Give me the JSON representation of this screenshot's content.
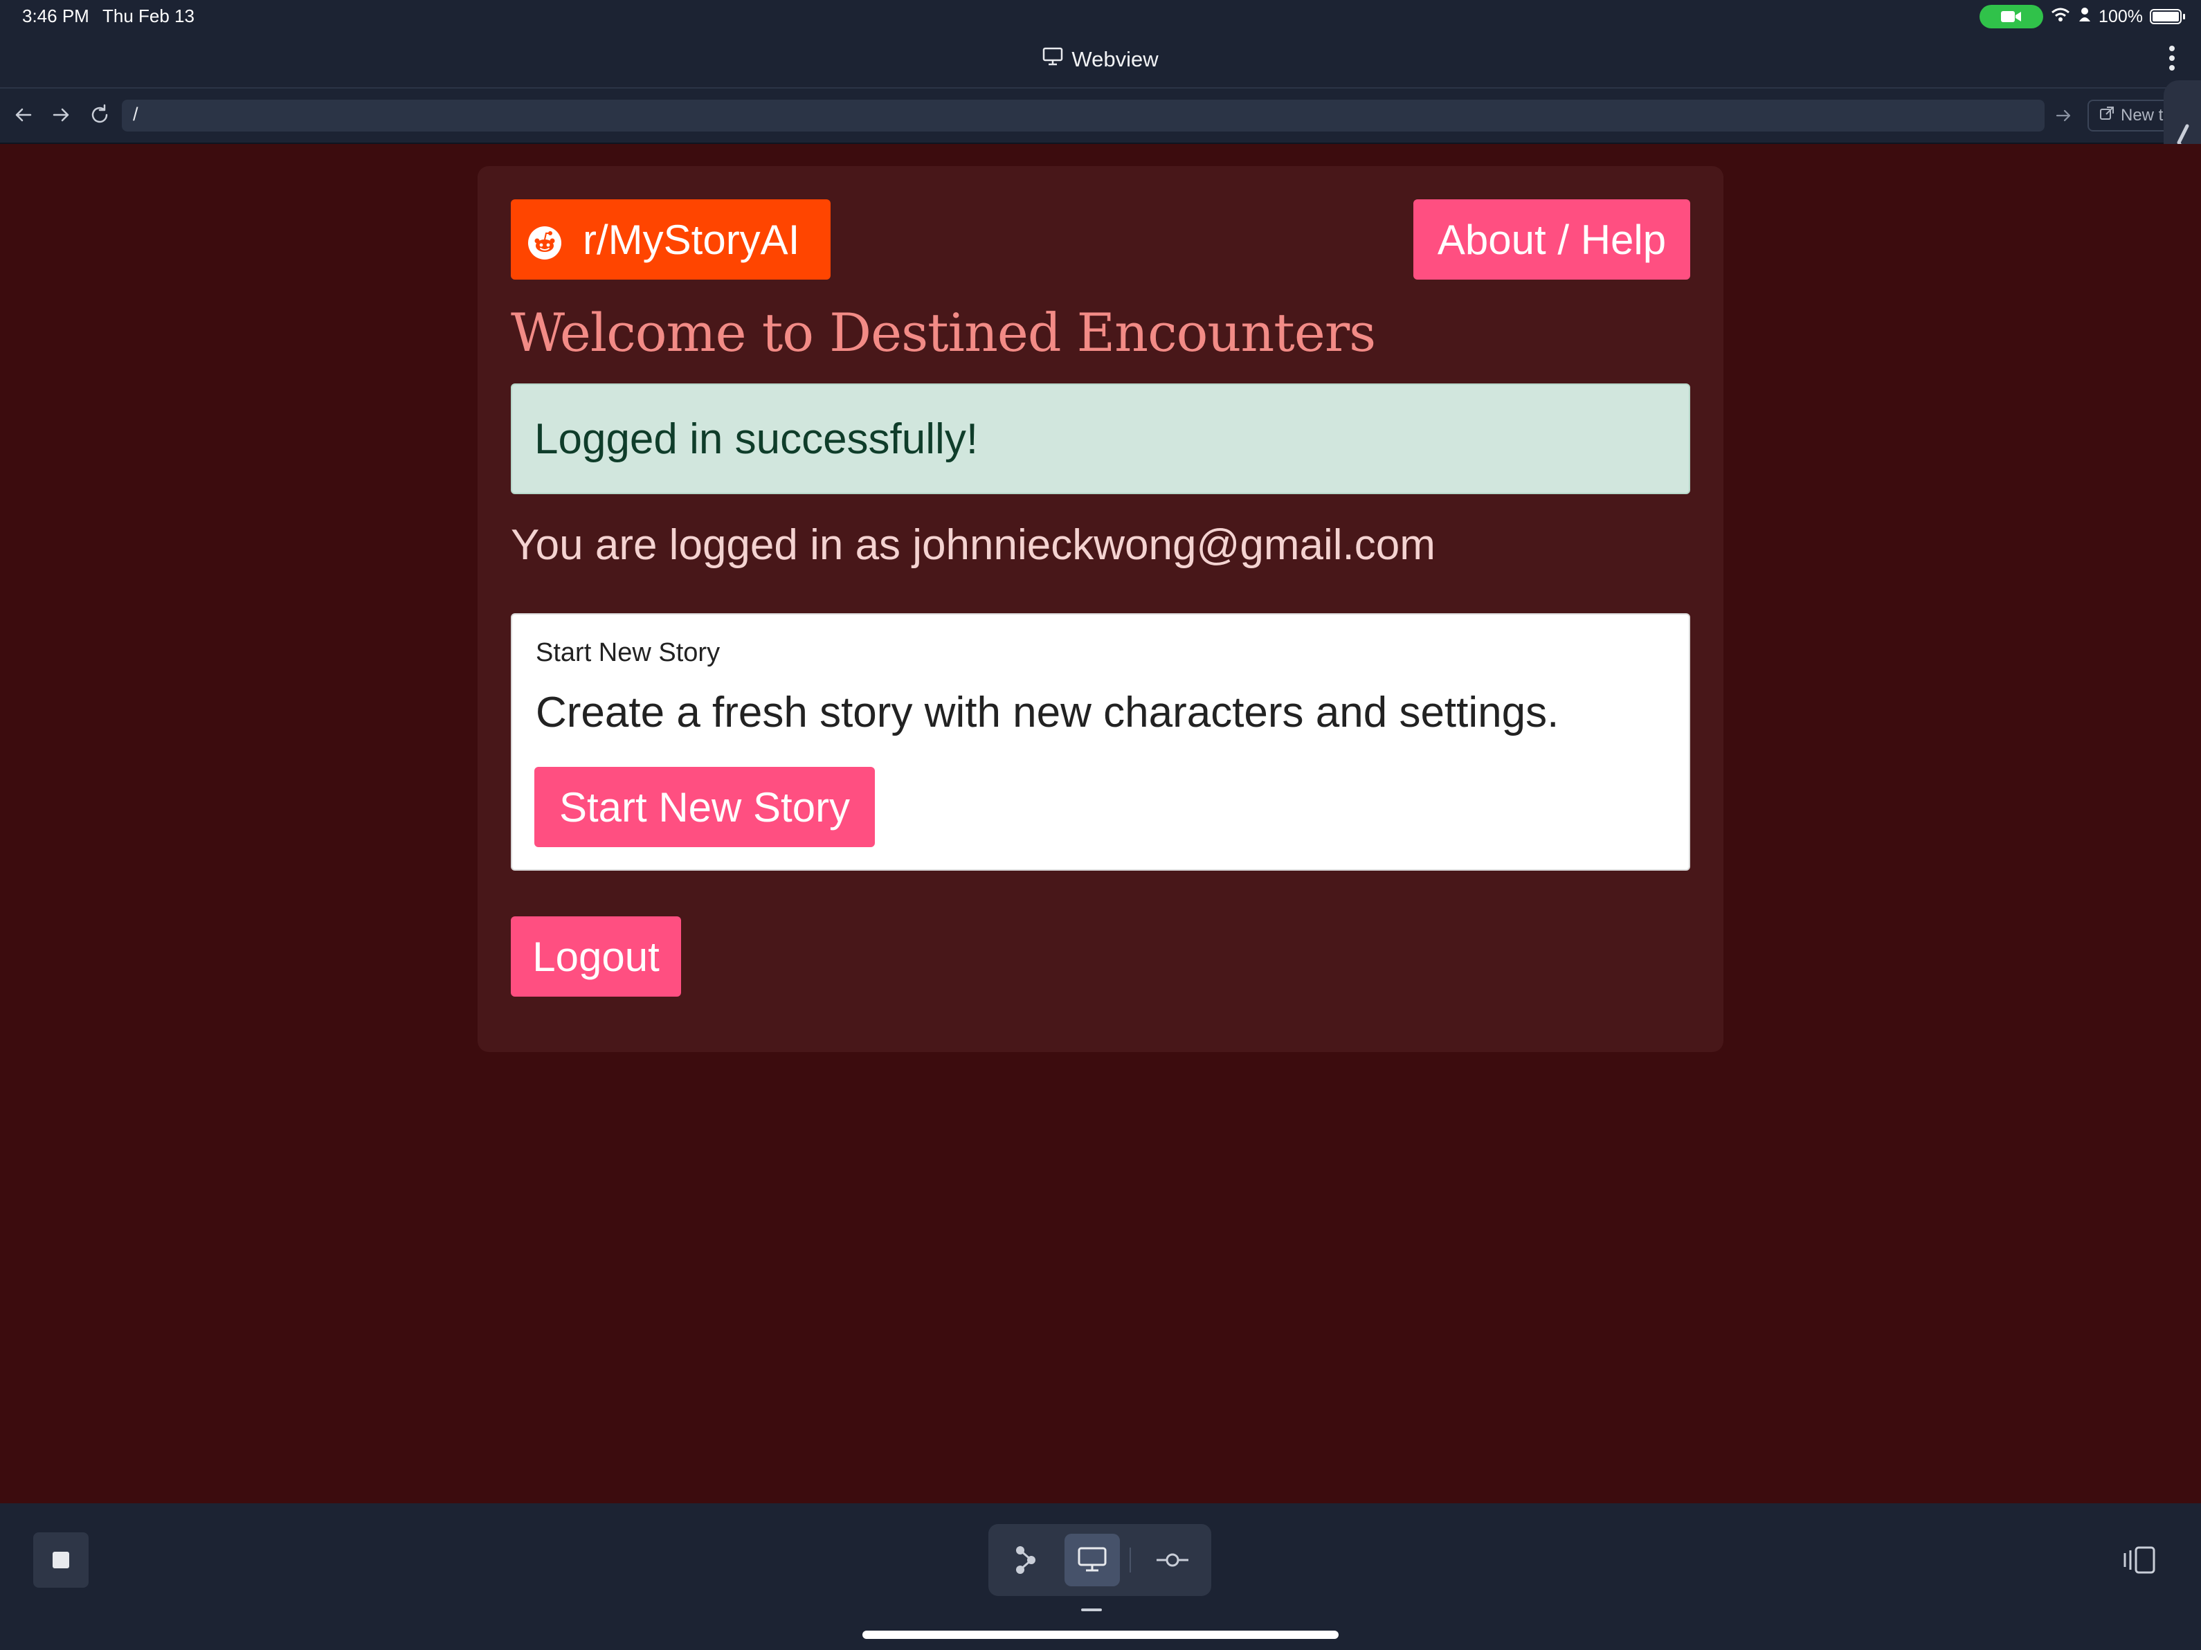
{
  "status_bar": {
    "time": "3:46 PM",
    "date": "Thu Feb 13",
    "battery": "100%"
  },
  "title_bar": {
    "title": "Webview"
  },
  "address_bar": {
    "url": "/",
    "new_tab_label": "New ta"
  },
  "page": {
    "reddit_link": "r/MyStoryAI",
    "about_link": "About / Help",
    "heading": "Welcome to Destined Encounters",
    "alert": "Logged in successfully!",
    "logged_in_as": "You are logged in as johnnieckwong@gmail.com",
    "story_card": {
      "title": "Start New Story",
      "text": "Create a fresh story with new characters and settings.",
      "button": "Start New Story"
    },
    "logout": "Logout"
  },
  "colors": {
    "page_background": "#3c0c0e",
    "card_background": "#481719",
    "accent_pink": "#ff4f81",
    "reddit_orange": "#ff4500",
    "heading": "#f28b86",
    "alert_background": "#d1e6dd",
    "chrome_background": "#1c2333"
  }
}
